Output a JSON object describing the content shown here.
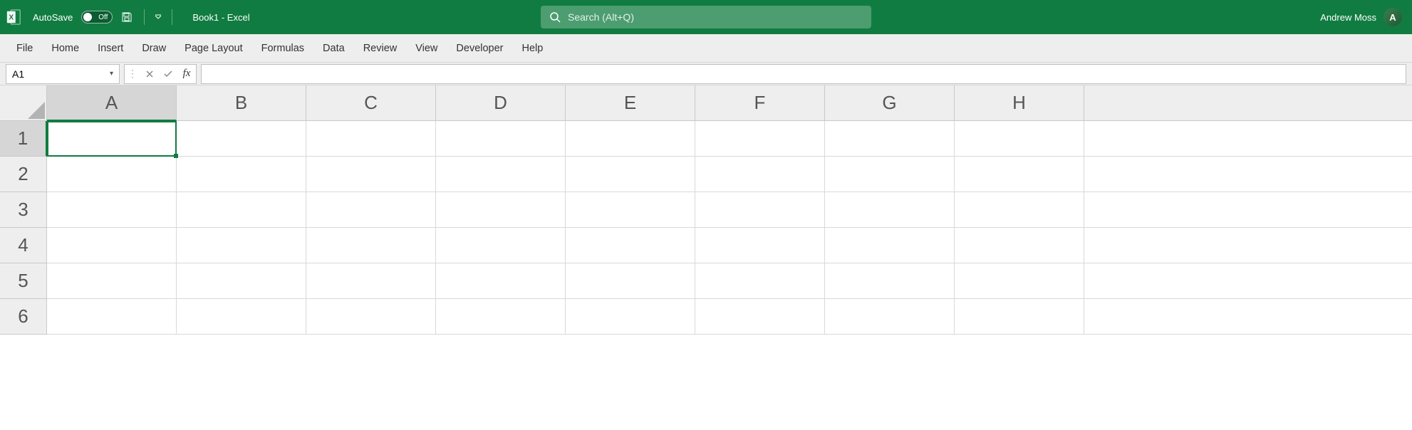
{
  "titlebar": {
    "autosave_label": "AutoSave",
    "autosave_state": "Off",
    "doc_title": "Book1  -  Excel",
    "user_name": "Andrew Moss",
    "avatar_initials": "A"
  },
  "search": {
    "placeholder": "Search (Alt+Q)"
  },
  "ribbon_tabs": [
    "File",
    "Home",
    "Insert",
    "Draw",
    "Page Layout",
    "Formulas",
    "Data",
    "Review",
    "View",
    "Developer",
    "Help"
  ],
  "name_box": {
    "value": "A1"
  },
  "formula_bar": {
    "value": ""
  },
  "grid": {
    "columns": [
      "A",
      "B",
      "C",
      "D",
      "E",
      "F",
      "G",
      "H"
    ],
    "rows": [
      "1",
      "2",
      "3",
      "4",
      "5",
      "6"
    ],
    "selected_cell": "A1"
  },
  "colors": {
    "primary": "#107c41"
  }
}
